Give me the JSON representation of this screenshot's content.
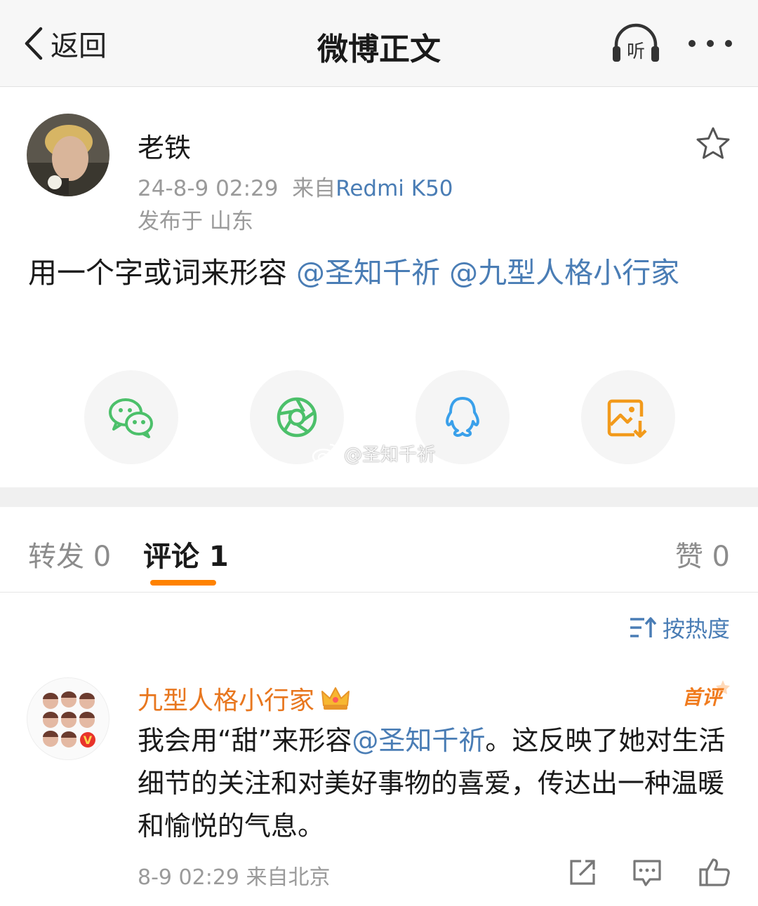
{
  "header": {
    "back_label": "返回",
    "title": "微博正文",
    "listen_label": "听"
  },
  "post": {
    "author": "老铁",
    "time": "24-8-9 02:29",
    "source_prefix": "来自",
    "device": "Redmi K50",
    "location": "发布于 山东",
    "text_plain": "用一个字或词来形容",
    "mention_1": "@圣知千祈",
    "mention_2": "@九型人格小行家"
  },
  "share": {
    "items": [
      "wechat-icon",
      "moments-icon",
      "qq-icon",
      "save-image-icon"
    ],
    "watermark": "@圣知千祈"
  },
  "tabs": {
    "repost": "转发 0",
    "comments": "评论 1",
    "likes": "赞 0"
  },
  "sort_label": "按热度",
  "comment": {
    "author": "九型人格小行家",
    "badge": "首评",
    "text_before": "我会用“甜”来形容",
    "mention": "@圣知千祈",
    "text_after": "。这反映了她对生活细节的关注和对美好事物的喜爱，传达出一种温暖和愉悦的气息。",
    "meta": "8-9 02:29  来自北京"
  },
  "colors": {
    "link": "#4a7db5",
    "accent": "#ff8200",
    "comment_author": "#e8771f"
  }
}
